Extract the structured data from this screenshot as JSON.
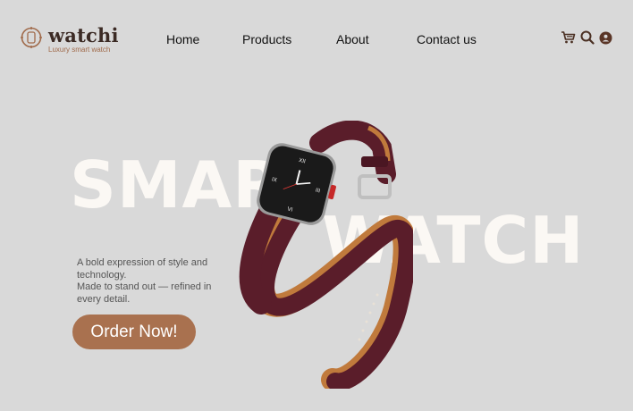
{
  "brand": {
    "name": "watchi",
    "tagline": "Luxury smart watch"
  },
  "nav": [
    {
      "label": "Home"
    },
    {
      "label": "Products"
    },
    {
      "label": "About"
    },
    {
      "label": "Contact us"
    }
  ],
  "icons": [
    "cart-icon",
    "search-icon",
    "user-icon"
  ],
  "hero": {
    "word1": "SMAR",
    "word2": "WATCH",
    "description_line1": "A bold expression of style and technology.",
    "description_line2": "Made to stand out — refined in every detail.",
    "cta_label": "Order Now!"
  },
  "colors": {
    "background": "#d9d9d9",
    "accent": "#a9714f",
    "brand_dark": "#3b2a24",
    "strap": "#5a1d2a",
    "strap_inner": "#c07a3c"
  }
}
